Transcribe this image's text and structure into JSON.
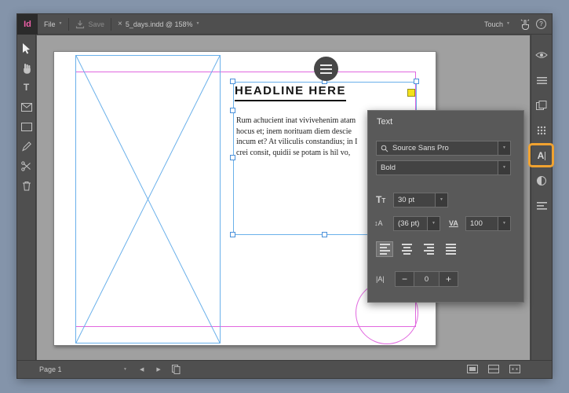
{
  "glyphs": {
    "caret": "▼",
    "close": "×",
    "prev": "◀",
    "next": "▶",
    "help": "?"
  },
  "topbar": {
    "logo": "Id",
    "file_label": "File",
    "save_label": "Save",
    "doc_title": "5_days.indd @ 158%",
    "touch_label": "Touch"
  },
  "left_toolbar": {
    "tools": [
      "selection-tool",
      "hand-tool",
      "type-tool",
      "image-frame-tool",
      "shape-tool",
      "pencil-tool",
      "scissors-tool",
      "delete-tool"
    ],
    "type_glyph": "T"
  },
  "right_toolbar": {
    "buttons": [
      "preview-eye",
      "menu",
      "pages-panel",
      "swatches-grid",
      "text-panel",
      "color",
      "layers"
    ],
    "text_panel_glyph": "A",
    "highlight_color": "#f0a230"
  },
  "canvas": {
    "headline": "HEADLINE HERE",
    "body_lines": [
      "Rum achucient inat vivivehenim atam",
      "hocus et; inem norituam diem descie",
      "incum et? At viliculis constandius; in I",
      "crei consit, quidii se potam is hil vo,"
    ],
    "guide_color": "#e168df",
    "frame_color": "#6ab0ea"
  },
  "text_panel": {
    "title": "Text",
    "font_name": "Source Sans Pro",
    "font_style": "Bold",
    "size_icon": "TT",
    "size_value": "30 pt",
    "leading_icon": "↕A",
    "leading_value": "(36 pt)",
    "tracking_icon": "VA",
    "tracking_value": "100",
    "baseline_icon": "|A|",
    "stepper": {
      "minus": "−",
      "value": "0",
      "plus": "+"
    }
  },
  "bottom_bar": {
    "page_label": "Page 1"
  }
}
